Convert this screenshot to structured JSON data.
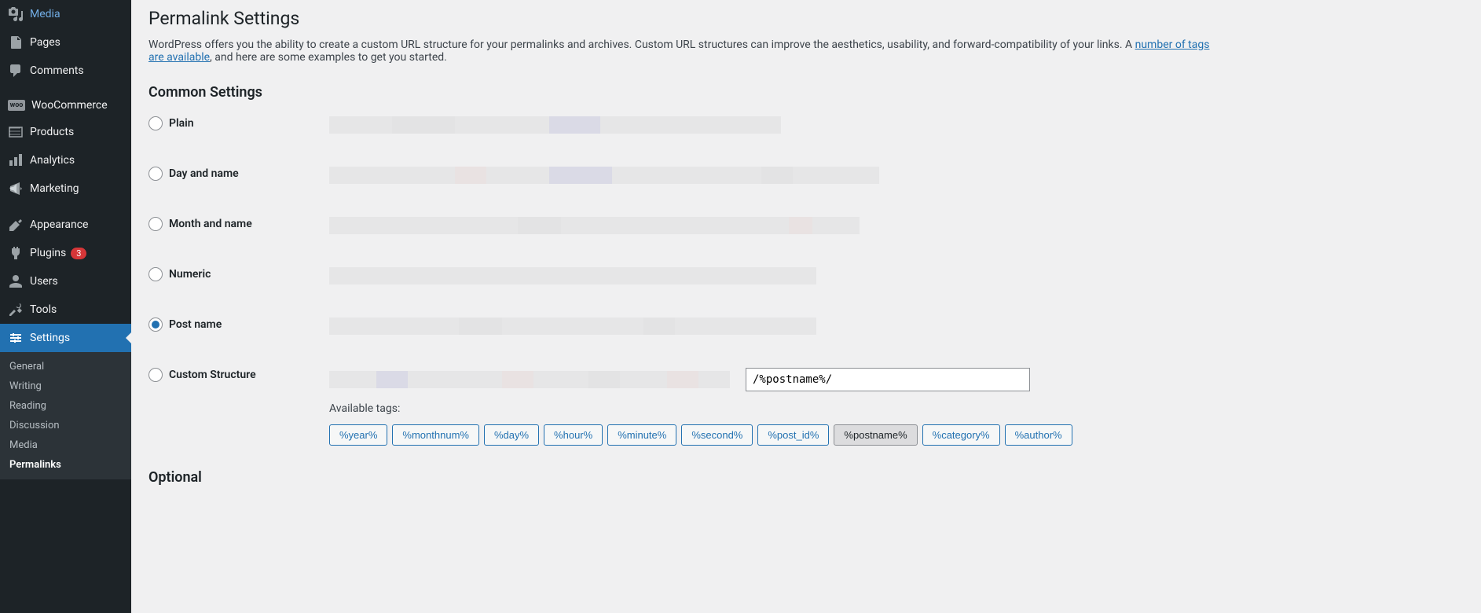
{
  "sidebar": {
    "main_items": [
      {
        "icon": "media",
        "label": "Media"
      },
      {
        "icon": "pages",
        "label": "Pages"
      },
      {
        "icon": "comments",
        "label": "Comments"
      }
    ],
    "woo_items": [
      {
        "icon": "woo",
        "label": "WooCommerce"
      },
      {
        "icon": "products",
        "label": "Products"
      },
      {
        "icon": "analytics",
        "label": "Analytics"
      },
      {
        "icon": "marketing",
        "label": "Marketing"
      }
    ],
    "admin_items": [
      {
        "icon": "appearance",
        "label": "Appearance"
      },
      {
        "icon": "plugins",
        "label": "Plugins",
        "badge": "3"
      },
      {
        "icon": "users",
        "label": "Users"
      },
      {
        "icon": "tools",
        "label": "Tools"
      },
      {
        "icon": "settings",
        "label": "Settings",
        "active": true
      }
    ],
    "submenu": [
      {
        "label": "General"
      },
      {
        "label": "Writing"
      },
      {
        "label": "Reading"
      },
      {
        "label": "Discussion"
      },
      {
        "label": "Media"
      },
      {
        "label": "Permalinks",
        "current": true
      }
    ]
  },
  "page": {
    "title": "Permalink Settings",
    "desc_pre": "WordPress offers you the ability to create a custom URL structure for your permalinks and archives. Custom URL structures can improve the aesthetics, usability, and forward-compatibility of your links. A ",
    "desc_link": "number of tags are available",
    "desc_post": ", and here are some examples to get you started.",
    "common_heading": "Common Settings",
    "options": [
      {
        "label": "Plain",
        "checked": false
      },
      {
        "label": "Day and name",
        "checked": false
      },
      {
        "label": "Month and name",
        "checked": false
      },
      {
        "label": "Numeric",
        "checked": false
      },
      {
        "label": "Post name",
        "checked": true
      },
      {
        "label": "Custom Structure",
        "checked": false
      }
    ],
    "custom_value": "/%postname%/",
    "available_label": "Available tags:",
    "tags": [
      {
        "label": "%year%",
        "active": false
      },
      {
        "label": "%monthnum%",
        "active": false
      },
      {
        "label": "%day%",
        "active": false
      },
      {
        "label": "%hour%",
        "active": false
      },
      {
        "label": "%minute%",
        "active": false
      },
      {
        "label": "%second%",
        "active": false
      },
      {
        "label": "%post_id%",
        "active": false
      },
      {
        "label": "%postname%",
        "active": true
      },
      {
        "label": "%category%",
        "active": false
      },
      {
        "label": "%author%",
        "active": false
      }
    ],
    "optional_heading": "Optional"
  }
}
